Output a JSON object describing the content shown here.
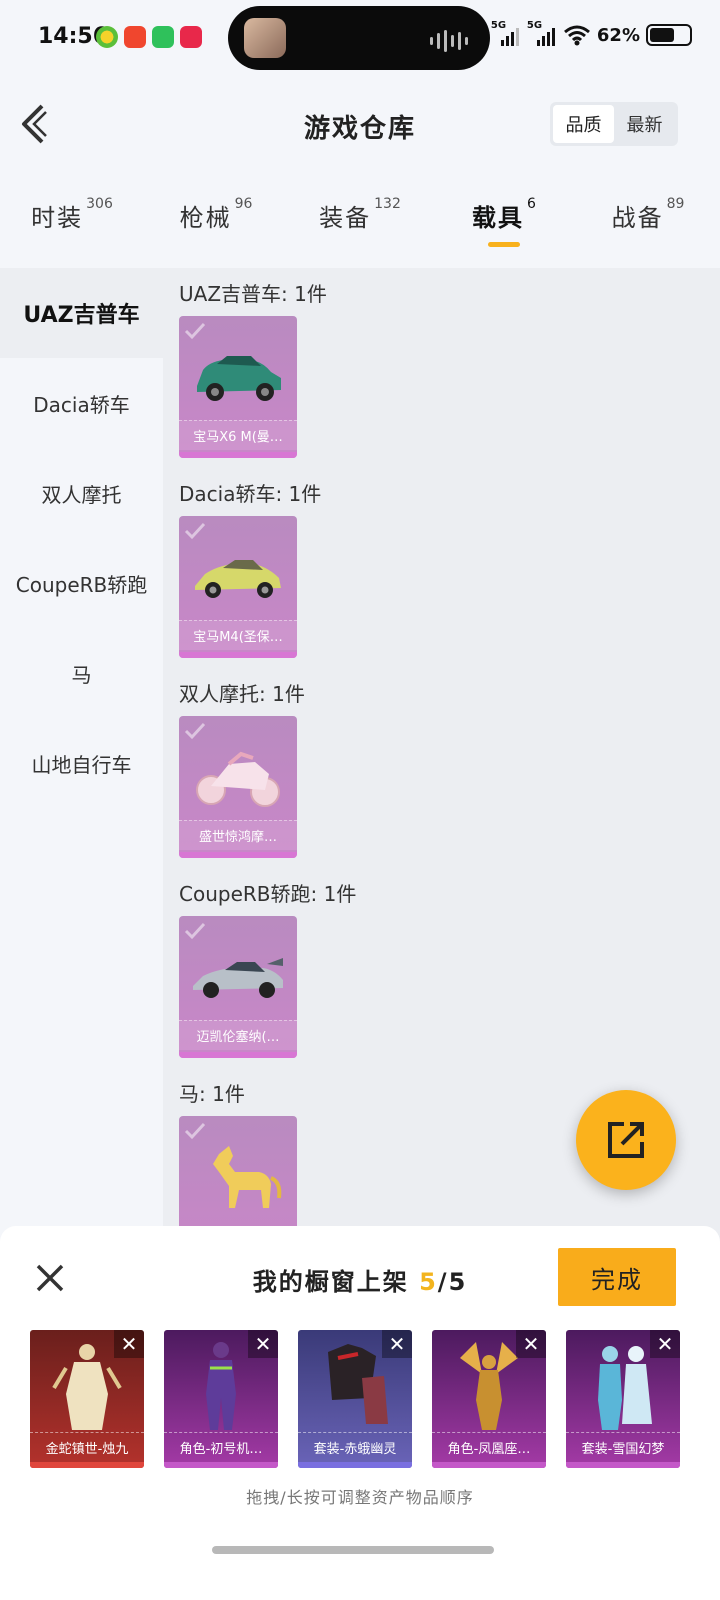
{
  "status_bar": {
    "time": "14:56",
    "network1": "5G",
    "network2": "5G",
    "battery": "62%",
    "battery_level": 0.62
  },
  "header": {
    "title": "游戏仓库",
    "sort_options": [
      "品质",
      "最新"
    ],
    "active_sort": "品质"
  },
  "tabs": [
    {
      "label": "时装",
      "count": "306"
    },
    {
      "label": "枪械",
      "count": "96"
    },
    {
      "label": "装备",
      "count": "132"
    },
    {
      "label": "载具",
      "count": "6"
    },
    {
      "label": "战备",
      "count": "89"
    }
  ],
  "active_tab": "载具",
  "sidebar": {
    "items": [
      "UAZ吉普车",
      "Dacia轿车",
      "双人摩托",
      "CoupeRB轿跑",
      "马",
      "山地自行车"
    ],
    "active": "UAZ吉普车"
  },
  "sections": [
    {
      "title": "UAZ吉普车: 1件",
      "item": "宝马X6 M(曼…",
      "icon": "suv-icon"
    },
    {
      "title": "Dacia轿车: 1件",
      "item": "宝马M4(圣保…",
      "icon": "sports-car-icon"
    },
    {
      "title": "双人摩托: 1件",
      "item": "盛世惊鸿摩…",
      "icon": "motorcycle-icon"
    },
    {
      "title": "CoupeRB轿跑: 1件",
      "item": "迈凯伦塞纳(…",
      "icon": "supercar-icon"
    },
    {
      "title": "马: 1件",
      "item": "",
      "icon": "horse-icon"
    }
  ],
  "bottom_sheet": {
    "title_prefix": "我的橱窗上架 ",
    "current": "5",
    "total": "/5",
    "done_label": "完成",
    "hint": "拖拽/长按可调整资产物品顺序",
    "showcase": [
      {
        "name": "金蛇镇世-烛九",
        "color_top": "#6a1f1c",
        "color_bottom": "#b4322c",
        "strip": "#e0463c"
      },
      {
        "name": "角色-初号机…",
        "color_top": "#4c1a5e",
        "color_bottom": "#a43aa6",
        "strip": "#c458c8"
      },
      {
        "name": "套装-赤蛾幽灵",
        "color_top": "#3a3a78",
        "color_bottom": "#6a64b8",
        "strip": "#7a6fe0"
      },
      {
        "name": "角色-凤凰座…",
        "color_top": "#4c1a5e",
        "color_bottom": "#a43aa6",
        "strip": "#c458c8"
      },
      {
        "name": "套装-雪国幻梦",
        "color_top": "#4c1a5e",
        "color_bottom": "#a43aa6",
        "strip": "#c458c8"
      }
    ]
  },
  "colors": {
    "accent": "#f8b11c",
    "card_purple": "#c986c8",
    "background": "#f4f6fa"
  }
}
